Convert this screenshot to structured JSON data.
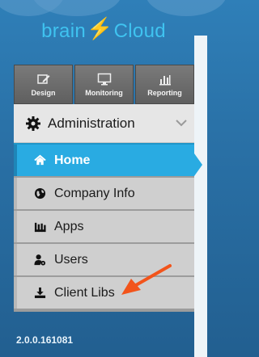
{
  "logo": {
    "text_left": "brain",
    "text_right": "Cloud"
  },
  "top_tabs": [
    {
      "label": "Design",
      "icon": "pencil-icon"
    },
    {
      "label": "Monitoring",
      "icon": "monitor-icon"
    },
    {
      "label": "Reporting",
      "icon": "bar-chart-icon"
    }
  ],
  "section": {
    "label": "Administration",
    "icon": "gear-icon",
    "expanded_icon": "chevron-down-icon"
  },
  "menu": [
    {
      "label": "Home",
      "icon": "home-icon",
      "active": true
    },
    {
      "label": "Company Info",
      "icon": "globe-icon",
      "active": false
    },
    {
      "label": "Apps",
      "icon": "factory-icon",
      "active": false
    },
    {
      "label": "Users",
      "icon": "user-gear-icon",
      "active": false
    },
    {
      "label": "Client Libs",
      "icon": "download-icon",
      "active": false
    }
  ],
  "version": "2.0.0.161081",
  "colors": {
    "active": "#29abe2",
    "annotation_arrow": "#f2541b",
    "bolt": "#f5e21b",
    "logo": "#3fc3f0"
  }
}
